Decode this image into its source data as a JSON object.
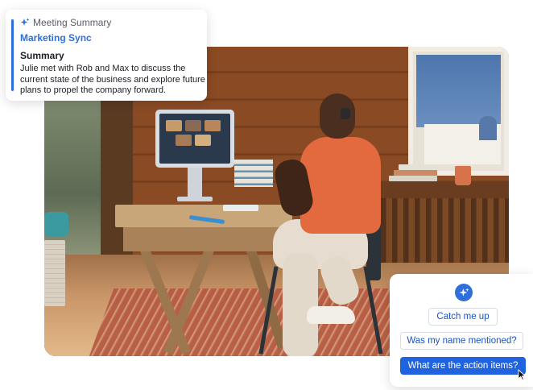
{
  "summary_card": {
    "header_label": "Meeting Summary",
    "meeting_title": "Marketing Sync",
    "section_title": "Summary",
    "summary_text": "Julie met with Rob and Max to discuss the current state of the business and explore future plans to propel the company forward.",
    "header_icon": "sparkle-icon",
    "accent_color": "#2e6fdc"
  },
  "ai_prompts": {
    "badge_icon": "sparkle-icon",
    "chips": [
      {
        "label": "Catch me up",
        "active": false
      },
      {
        "label": "Was my name mentioned?",
        "active": false
      },
      {
        "label": "What are the action items?",
        "active": true
      }
    ],
    "accent_color": "#1f63e0"
  },
  "photo": {
    "icon": "office-photo"
  }
}
